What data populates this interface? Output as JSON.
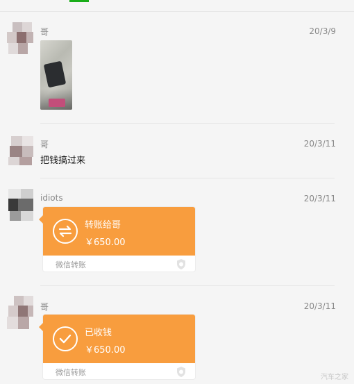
{
  "messages": [
    {
      "sender": "哥",
      "time": "20/3/9",
      "type": "image"
    },
    {
      "sender": "哥",
      "time": "20/3/11",
      "type": "text",
      "text": "把钱搞过来"
    },
    {
      "sender": "idiots",
      "time": "20/3/11",
      "type": "transfer",
      "transfer": {
        "title": "转账给哥",
        "amount": "￥650.00",
        "footer": "微信转账",
        "icon": "transfer-arrows-icon"
      }
    },
    {
      "sender": "哥",
      "time": "20/3/11",
      "type": "transfer",
      "transfer": {
        "title": "已收钱",
        "amount": "￥650.00",
        "footer": "微信转账",
        "icon": "check-circle-icon"
      }
    }
  ],
  "colors": {
    "transfer_orange": "#f89d3e",
    "accent_green": "#1aad19",
    "background": "#f5f5f5"
  },
  "watermark": "汽车之家"
}
